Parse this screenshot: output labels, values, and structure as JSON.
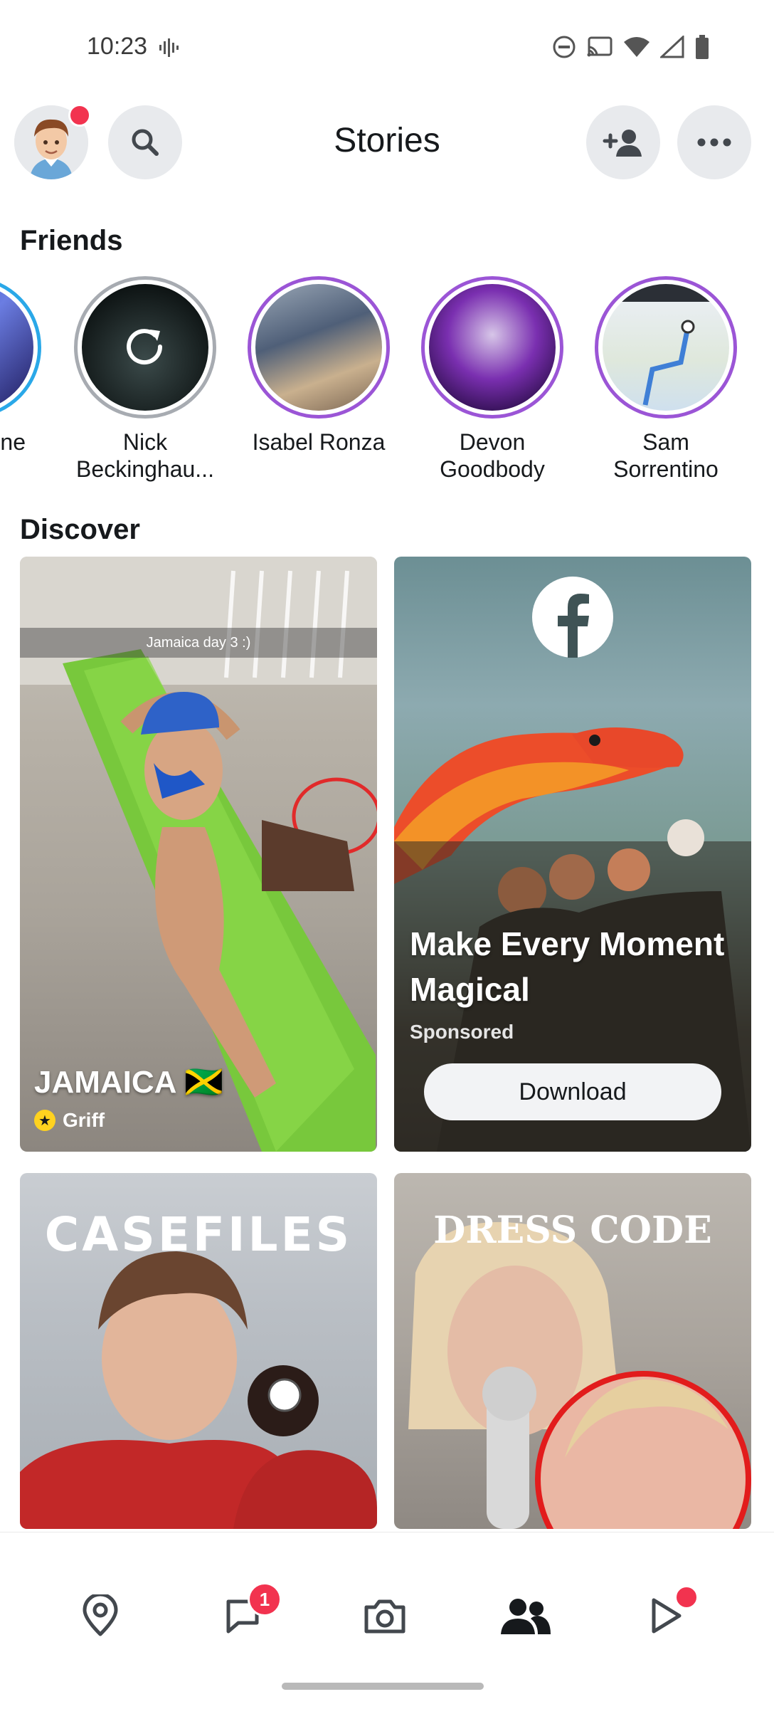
{
  "status_bar": {
    "time": "10:23"
  },
  "header": {
    "title": "Stories"
  },
  "friends": {
    "section_title": "Friends",
    "items": [
      {
        "name_line1": "ne",
        "name_line2": ""
      },
      {
        "name_line1": "Nick",
        "name_line2": "Beckinghau..."
      },
      {
        "name_line1": "Isabel Ronza",
        "name_line2": ""
      },
      {
        "name_line1": "Devon",
        "name_line2": "Goodbody"
      },
      {
        "name_line1": "Sam",
        "name_line2": "Sorrentino"
      }
    ]
  },
  "discover": {
    "section_title": "Discover",
    "cards": [
      {
        "caption": "Jamaica day 3 :)",
        "title": "JAMAICA 🇯🇲",
        "publisher": "Griff"
      },
      {
        "title": "Make Every Moment Magical",
        "label": "Sponsored",
        "button": "Download"
      },
      {
        "title": "CASEFILES"
      },
      {
        "title": "DRESS CODE"
      }
    ]
  },
  "bottom_nav": {
    "chat_badge": "1"
  },
  "colors": {
    "accent_purple": "#9b55d6",
    "badge_red": "#f2334f",
    "bitmoji_yellow": "#ffd21f"
  }
}
